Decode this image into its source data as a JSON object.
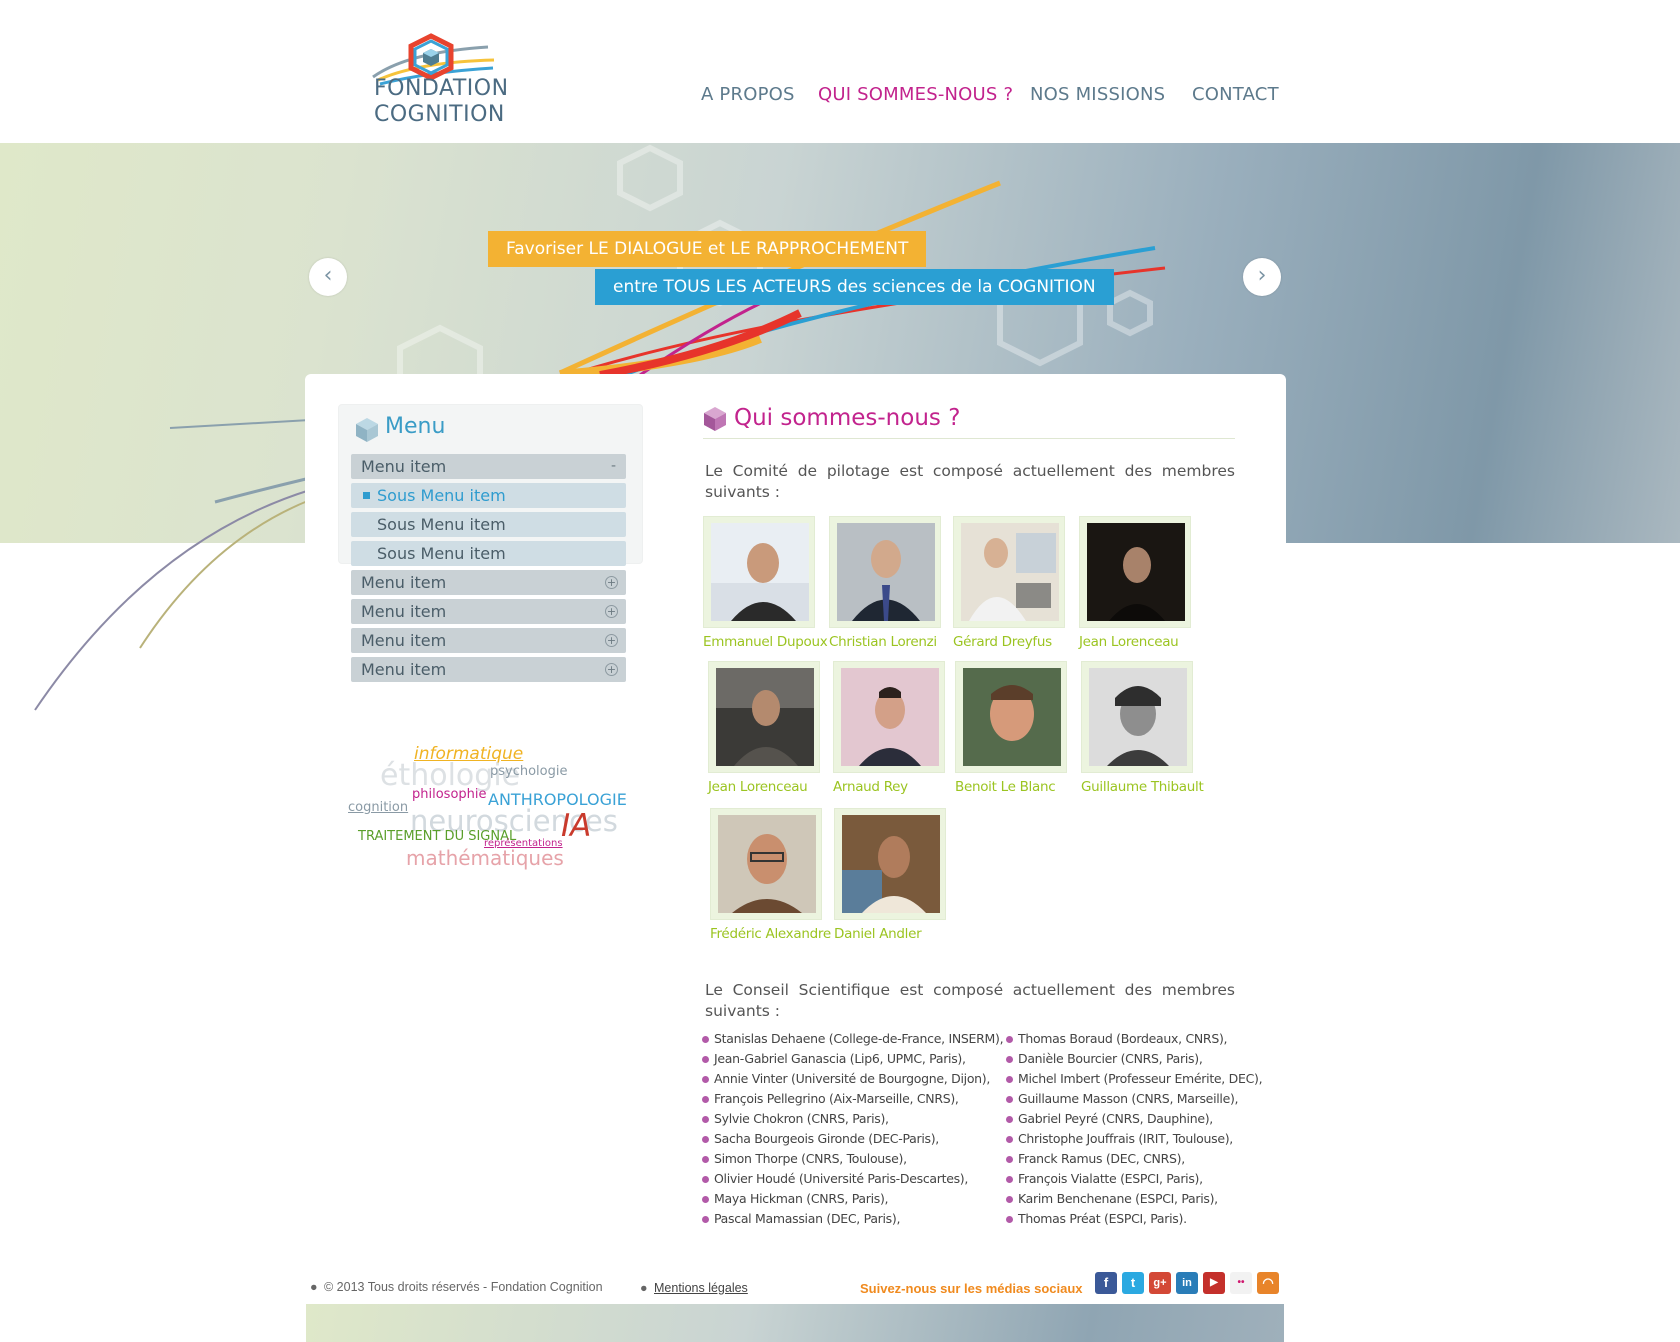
{
  "brand": {
    "line1": "FONDATION",
    "line2": "COGNITION"
  },
  "nav": {
    "items": [
      {
        "label": "A PROPOS"
      },
      {
        "label": "QUI SOMMES-NOUS ?"
      },
      {
        "label": "NOS MISSIONS"
      },
      {
        "label": "CONTACT"
      }
    ]
  },
  "banner": {
    "line1": "Favoriser LE DIALOGUE et LE RAPPROCHEMENT",
    "line2": "entre TOUS LES ACTEURS des sciences de la COGNITION",
    "prev": "‹",
    "next": "›"
  },
  "sidebar": {
    "title": "Menu",
    "items": [
      {
        "label": "Menu item",
        "toggle": "-"
      },
      {
        "label": "Sous Menu item"
      },
      {
        "label": "Sous Menu item"
      },
      {
        "label": "Sous Menu item"
      },
      {
        "label": "Menu item",
        "toggle": "+"
      },
      {
        "label": "Menu item",
        "toggle": "+"
      },
      {
        "label": "Menu item",
        "toggle": "+"
      },
      {
        "label": "Menu item",
        "toggle": "+"
      }
    ]
  },
  "cloud": {
    "words": [
      "informatique",
      "éthologie",
      "psychologie",
      "philosophie",
      "cognition",
      "ANTHROPOLOGIE",
      "neurosciences",
      "IA",
      "TRAITEMENT DU SIGNAL",
      "représentations",
      "mathématiques"
    ]
  },
  "content": {
    "title": "Qui sommes-nous ?",
    "intro_committee": "Le Comité de pilotage est composé actuellement des membres suivants :",
    "members": [
      "Emmanuel Dupoux",
      "Christian Lorenzi",
      "Gérard Dreyfus",
      "Jean Lorenceau",
      "Jean Lorenceau",
      "Arnaud Rey",
      "Benoit Le Blanc",
      "Guillaume Thibault",
      "Frédéric Alexandre",
      "Daniel Andler"
    ],
    "intro_council": "Le Conseil Scientifique est composé actuellement des membres suivants :",
    "council_left": [
      "Stanislas Dehaene (College-de-France, INSERM),",
      "Jean-Gabriel Ganascia (Lip6, UPMC, Paris),",
      "Annie Vinter (Université de Bourgogne, Dijon),",
      "François Pellegrino (Aix-Marseille, CNRS),",
      "Sylvie Chokron (CNRS, Paris),",
      "Sacha Bourgeois Gironde (DEC-Paris),",
      "Simon Thorpe (CNRS, Toulouse),",
      "Olivier Houdé (Université Paris-Descartes),",
      "Maya Hickman (CNRS, Paris),",
      "Pascal Mamassian (DEC, Paris),"
    ],
    "council_right": [
      "Thomas Boraud (Bordeaux, CNRS),",
      "Danièle Bourcier (CNRS, Paris),",
      "Michel Imbert (Professeur Emérite, DEC),",
      "Guillaume Masson (CNRS, Marseille),",
      "Gabriel Peyré (CNRS, Dauphine),",
      "Christophe Jouffrais (IRIT, Toulouse),",
      "Franck Ramus (DEC, CNRS),",
      "François Vialatte (ESPCI, Paris),",
      "Karim Benchenane (ESPCI, Paris),",
      "Thomas Préat (ESPCI, Paris)."
    ]
  },
  "footer": {
    "copyright": "© 2013 Tous droits réservés - Fondation Cognition",
    "legal": "Mentions légales",
    "follow": "Suivez-nous sur les médias sociaux",
    "social": [
      {
        "name": "facebook-icon",
        "glyph": "f",
        "color": "#3b5998"
      },
      {
        "name": "twitter-icon",
        "glyph": "t",
        "color": "#2ba9e1"
      },
      {
        "name": "google-plus-icon",
        "glyph": "g+",
        "color": "#d34836"
      },
      {
        "name": "linkedin-icon",
        "glyph": "in",
        "color": "#2a7db8"
      },
      {
        "name": "youtube-icon",
        "glyph": "▶",
        "color": "#c4302b"
      },
      {
        "name": "flickr-icon",
        "glyph": "••",
        "color": "#f2f2f2"
      },
      {
        "name": "rss-icon",
        "glyph": "◠",
        "color": "#e8842a"
      }
    ]
  },
  "colors": {
    "accent": "#c2238d",
    "link": "#9bc421",
    "blue": "#3a9cc6"
  }
}
